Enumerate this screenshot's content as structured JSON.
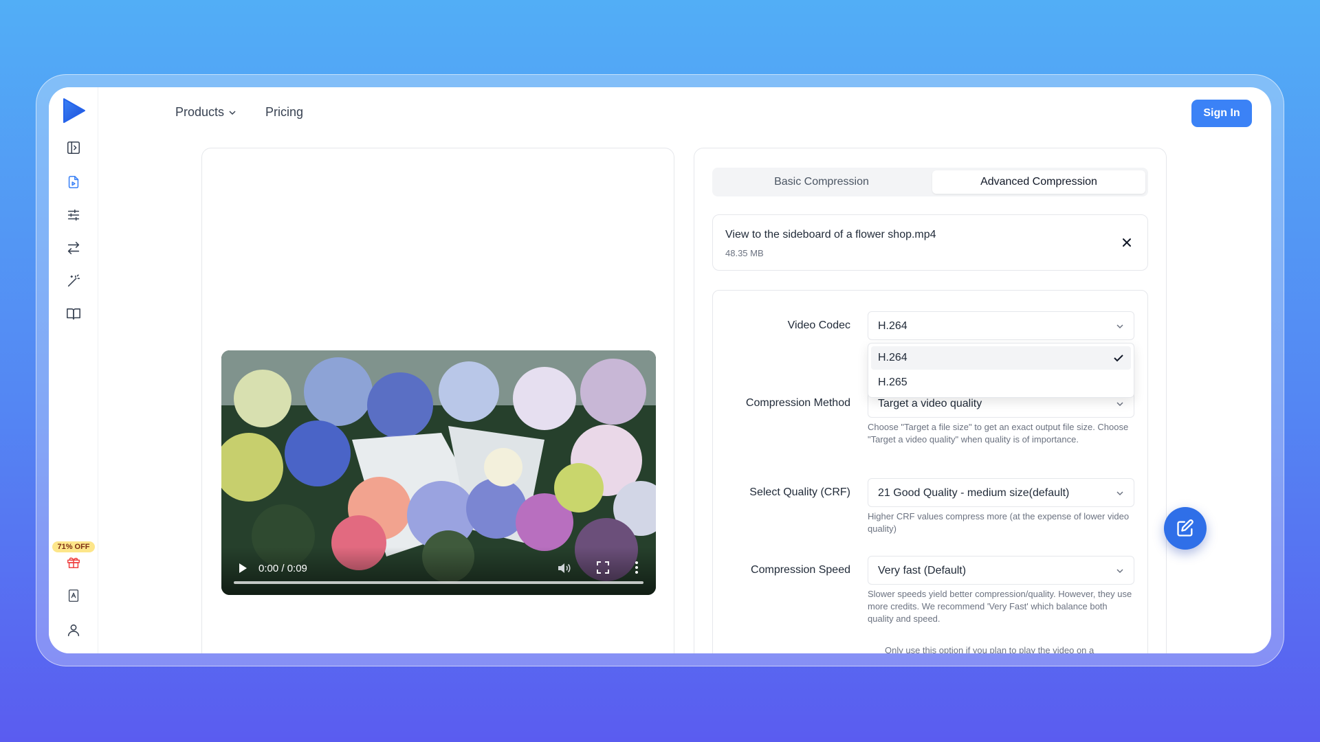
{
  "nav": {
    "products_label": "Products",
    "pricing_label": "Pricing",
    "signin_label": "Sign In"
  },
  "sidebar": {
    "items": [
      {
        "name": "sidebar-toggle",
        "icon": "panel-toggle-icon"
      },
      {
        "name": "compress",
        "icon": "file-video-icon"
      },
      {
        "name": "adjust",
        "icon": "sliders-icon"
      },
      {
        "name": "convert",
        "icon": "arrows-swap-icon"
      },
      {
        "name": "enhance",
        "icon": "magic-wand-icon"
      },
      {
        "name": "guides",
        "icon": "book-icon"
      }
    ],
    "promo_badge": "71% OFF",
    "bottom": [
      {
        "name": "gift",
        "icon": "gift-icon"
      },
      {
        "name": "ai-tool",
        "icon": "ai-doc-icon"
      },
      {
        "name": "account",
        "icon": "user-icon"
      }
    ]
  },
  "player": {
    "time": "0:00 / 0:09",
    "progress": 0
  },
  "tabs": {
    "basic": "Basic Compression",
    "advanced": "Advanced Compression",
    "active": "advanced"
  },
  "file": {
    "name": "View to the sideboard of a flower shop.mp4",
    "size": "48.35 MB"
  },
  "settings": {
    "video_codec": {
      "label": "Video Codec",
      "value": "H.264",
      "options": [
        "H.264",
        "H.265"
      ],
      "selected": "H.264"
    },
    "compression_method": {
      "label": "Compression Method",
      "value": "Target a video quality",
      "help": "Choose \"Target a file size\" to get an exact output file size. Choose \"Target a video quality\" when quality is of importance."
    },
    "quality": {
      "label": "Select Quality (CRF)",
      "value": "21 Good Quality - medium size(default)",
      "help": "Higher CRF values compress more (at the expense of lower video quality)"
    },
    "speed": {
      "label": "Compression Speed",
      "value": "Very fast (Default)",
      "help": "Slower speeds yield better compression/quality. However, they use more credits. We recommend 'Very Fast' which balance both quality and speed."
    },
    "cut_note": "Only use this option if you plan to play the video on a"
  },
  "colors": {
    "accent": "#3b82f6",
    "fab": "#2f6fe8",
    "badge_bg": "#fde68a"
  }
}
